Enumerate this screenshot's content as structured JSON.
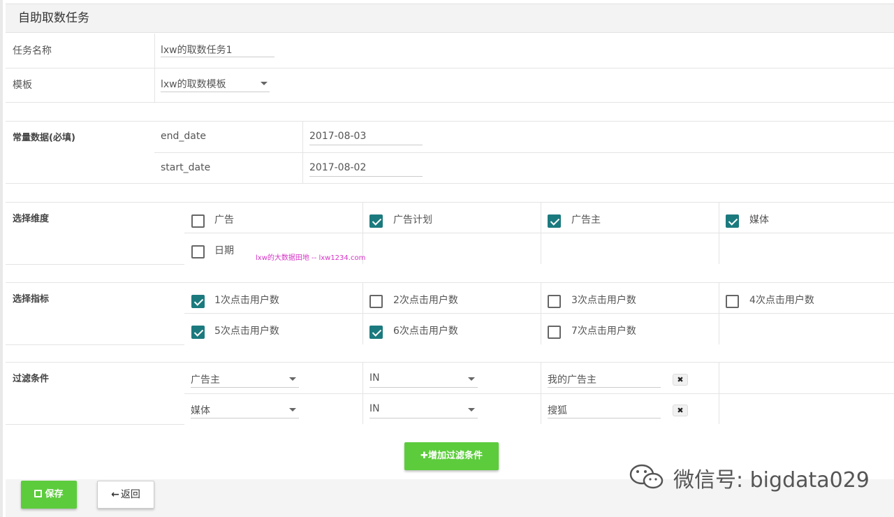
{
  "panel": {
    "title": "自助取数任务"
  },
  "task_name": {
    "label": "任务名称",
    "value": "lxw的取数任务1"
  },
  "template": {
    "label": "模板",
    "value": "lxw的取数模板"
  },
  "constants": {
    "label": "常量数据(必填)",
    "rows": [
      {
        "key": "end_date",
        "value": "2017-08-03"
      },
      {
        "key": "start_date",
        "value": "2017-08-02"
      }
    ]
  },
  "dimensions": {
    "label": "选择维度",
    "items": [
      {
        "label": "广告",
        "checked": false
      },
      {
        "label": "广告计划",
        "checked": true
      },
      {
        "label": "广告主",
        "checked": true
      },
      {
        "label": "媒体",
        "checked": true
      },
      {
        "label": "日期",
        "checked": false
      }
    ]
  },
  "metrics": {
    "label": "选择指标",
    "items": [
      {
        "label": "1次点击用户数",
        "checked": true
      },
      {
        "label": "2次点击用户数",
        "checked": false
      },
      {
        "label": "3次点击用户数",
        "checked": false
      },
      {
        "label": "4次点击用户数",
        "checked": false
      },
      {
        "label": "5次点击用户数",
        "checked": true
      },
      {
        "label": "6次点击用户数",
        "checked": true
      },
      {
        "label": "7次点击用户数",
        "checked": false
      }
    ]
  },
  "filters": {
    "label": "过滤条件",
    "rows": [
      {
        "field": "广告主",
        "op": "IN",
        "value": "我的广告主",
        "remove": "✖"
      },
      {
        "field": "媒体",
        "op": "IN",
        "value": "搜狐",
        "remove": "✖"
      }
    ],
    "add_label": "✚增加过滤条件"
  },
  "footer": {
    "save_label": "保存",
    "back_label": "返回"
  },
  "watermarks": {
    "site": "lxw的大数据田地 -- lxw1234.com",
    "wechat": "微信号: bigdata029"
  },
  "colors": {
    "checked": "#1b7a7e",
    "green_button": "#5ccc3c"
  }
}
